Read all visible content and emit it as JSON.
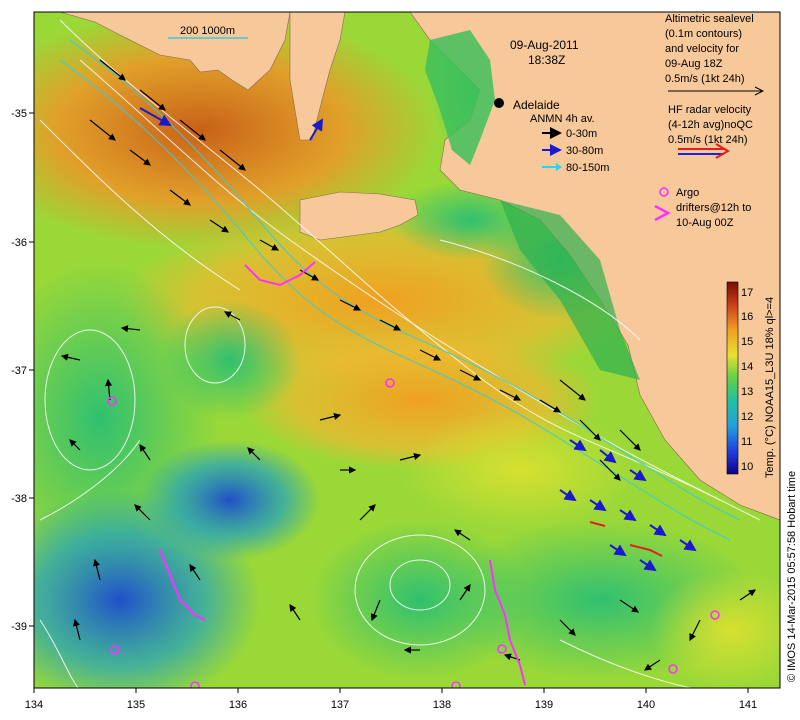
{
  "map": {
    "date_line1": "09-Aug-2011",
    "date_line2": "18:38Z",
    "city": "Adelaide",
    "scale_label": "200  1000m",
    "x_ticks": [
      "134",
      "135",
      "136",
      "137",
      "138",
      "139",
      "140",
      "141"
    ],
    "y_ticks": [
      "-35",
      "-36",
      "-37",
      "-38",
      "-39"
    ],
    "colors": {
      "land": "#f7c89a",
      "coast": "#c8c8c8",
      "sst_cool": "#1e6fd8",
      "sst_mid": "#32c86e",
      "sst_warm": "#f0a020",
      "sst_hot": "#b05010",
      "anmn_0_30": "#000000",
      "anmn_30_80": "#1a1acc",
      "anmn_80_150": "#2fd0f0",
      "argo": "#ff30ff",
      "hf_red": "#e02020",
      "hf_blue": "#2020e0"
    }
  },
  "legend": {
    "altimetry": [
      "Altimetric sealevel",
      "(0.1m contours)",
      "and velocity for",
      "09-Aug 18Z",
      "0.5m/s (1kt 24h)"
    ],
    "hf_radar": [
      "HF radar velocity",
      "(4-12h avg)noQC",
      "0.5m/s (1kt 24h)"
    ],
    "anmn": {
      "title": "ANMN 4h av.",
      "items": [
        "0-30m",
        "30-80m",
        "80-150m"
      ]
    },
    "argo": [
      "Argo",
      "drifters@12h to",
      "10-Aug 00Z"
    ]
  },
  "colorbar": {
    "label": "Temp. (°C) NOAA15_L3U 18% ql>=4",
    "ticks": [
      "17",
      "16",
      "15",
      "14",
      "13",
      "12",
      "11",
      "10"
    ]
  },
  "credit": "© IMOS 14-Mar-2015 05:57:58 Hobart time"
}
